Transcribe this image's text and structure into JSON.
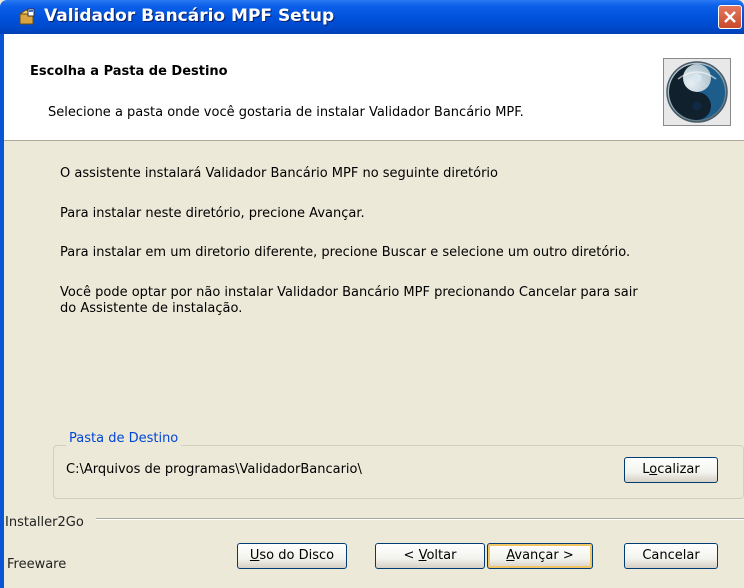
{
  "window": {
    "title": "Validador Bancário MPF Setup"
  },
  "header": {
    "title": "Escolha a Pasta de Destino",
    "subtitle": "Selecione a pasta onde você gostaria de instalar Validador Bancário MPF."
  },
  "body": {
    "line1": "O assistente instalará Validador Bancário MPF no seguinte diretório",
    "line2": "Para instalar neste diretório, precione Avançar.",
    "line3": "Para instalar em um diretorio diferente, precione Buscar e selecione um outro diretório.",
    "line4a": "Você pode optar por não instalar Validador Bancário MPF precionando Cancelar para sair",
    "line4b": "do Assistente de instalação."
  },
  "destination": {
    "group_label": "Pasta de Destino",
    "path": "C:\\Arquivos de programas\\ValidadorBancario\\",
    "browse_pre": "L",
    "browse_mn": "o",
    "browse_post": "calizar"
  },
  "footer": {
    "brand": "Installer2Go",
    "license": "Freeware"
  },
  "buttons": {
    "disk_mn": "U",
    "disk_post": "so do Disco",
    "back_pre": "< ",
    "back_mn": "V",
    "back_post": "oltar",
    "next_mn": "A",
    "next_post": "vançar >",
    "cancel": "Cancelar"
  },
  "colors": {
    "title_bar": "#0051da",
    "dialog_bg": "#ECE9D8",
    "group_label": "#0046d5",
    "close_button": "#c94a2c"
  },
  "icons": {
    "title": "installer-box-icon",
    "close": "close-icon",
    "logo": "yin-yang-logo"
  }
}
